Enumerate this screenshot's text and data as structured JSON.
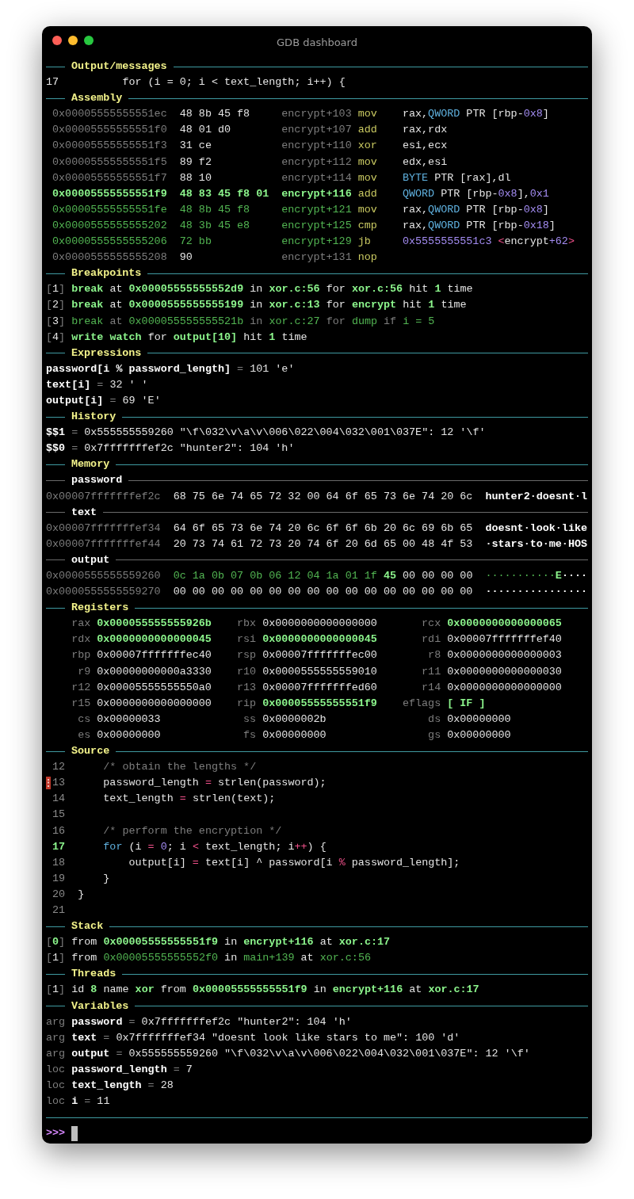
{
  "window": {
    "title": "GDB dashboard"
  },
  "sections": [
    {
      "title": "Output/messages",
      "kind": "msg",
      "lines": [
        {
          "cells": [
            [
              {
                "text": "17",
                "kind": "plain"
              }
            ],
            [
              {
                "text": "for (i = 0; i < text_length; i++) {",
                "kind": "plain"
              }
            ]
          ]
        }
      ]
    },
    {
      "title": "Assembly",
      "kind": "asm",
      "lines": [
        {
          "cells": [
            [
              {
                "text": "0x00005555555551ec",
                "kind": "dim"
              }
            ],
            [
              {
                "text": "48 8b 45 f8",
                "kind": "plain"
              }
            ],
            [
              {
                "text": "encrypt+103",
                "kind": "dim"
              }
            ],
            [
              {
                "text": "mov",
                "kind": "yellow"
              }
            ],
            [
              {
                "text": "rax,",
                "kind": "plain"
              },
              {
                "text": "QWORD",
                "kind": "cyan"
              },
              {
                "text": " PTR [rbp-",
                "kind": "plain"
              },
              {
                "text": "0x8",
                "kind": "purple"
              },
              {
                "text": "]",
                "kind": "plain"
              }
            ]
          ]
        },
        {
          "cells": [
            [
              {
                "text": "0x00005555555551f0",
                "kind": "dim"
              }
            ],
            [
              {
                "text": "48 01 d0",
                "kind": "plain"
              }
            ],
            [
              {
                "text": "encrypt+107",
                "kind": "dim"
              }
            ],
            [
              {
                "text": "add",
                "kind": "yellow"
              }
            ],
            [
              {
                "text": "rax,rdx",
                "kind": "plain"
              }
            ]
          ]
        },
        {
          "cells": [
            [
              {
                "text": "0x00005555555551f3",
                "kind": "dim"
              }
            ],
            [
              {
                "text": "31 ce",
                "kind": "plain"
              }
            ],
            [
              {
                "text": "encrypt+110",
                "kind": "dim"
              }
            ],
            [
              {
                "text": "xor",
                "kind": "yellow"
              }
            ],
            [
              {
                "text": "esi,ecx",
                "kind": "plain"
              }
            ]
          ]
        },
        {
          "cells": [
            [
              {
                "text": "0x00005555555551f5",
                "kind": "dim"
              }
            ],
            [
              {
                "text": "89 f2",
                "kind": "plain"
              }
            ],
            [
              {
                "text": "encrypt+112",
                "kind": "dim"
              }
            ],
            [
              {
                "text": "mov",
                "kind": "yellow"
              }
            ],
            [
              {
                "text": "edx,esi",
                "kind": "plain"
              }
            ]
          ]
        },
        {
          "cells": [
            [
              {
                "text": "0x00005555555551f7",
                "kind": "dim"
              }
            ],
            [
              {
                "text": "88 10",
                "kind": "plain"
              }
            ],
            [
              {
                "text": "encrypt+114",
                "kind": "dim"
              }
            ],
            [
              {
                "text": "mov",
                "kind": "yellow"
              }
            ],
            [
              {
                "text": "BYTE",
                "kind": "cyan"
              },
              {
                "text": " PTR [rax],dl",
                "kind": "plain"
              }
            ]
          ]
        },
        {
          "cells": [
            [
              {
                "text": "0x00005555555551f9",
                "kind": "hi"
              }
            ],
            [
              {
                "text": "48 83 45 f8 01",
                "kind": "hi"
              }
            ],
            [
              {
                "text": "encrypt+116",
                "kind": "hi"
              }
            ],
            [
              {
                "text": "add",
                "kind": "yellow"
              }
            ],
            [
              {
                "text": "QWORD",
                "kind": "cyan"
              },
              {
                "text": " PTR [rbp-",
                "kind": "plain"
              },
              {
                "text": "0x8",
                "kind": "purple"
              },
              {
                "text": "],",
                "kind": "plain"
              },
              {
                "text": "0x1",
                "kind": "purple"
              }
            ]
          ]
        },
        {
          "cells": [
            [
              {
                "text": "0x00005555555551fe",
                "kind": "green"
              }
            ],
            [
              {
                "text": "48 8b 45 f8",
                "kind": "green"
              }
            ],
            [
              {
                "text": "encrypt+121",
                "kind": "green"
              }
            ],
            [
              {
                "text": "mov",
                "kind": "yellow"
              }
            ],
            [
              {
                "text": "rax,",
                "kind": "plain"
              },
              {
                "text": "QWORD",
                "kind": "cyan"
              },
              {
                "text": " PTR [rbp-",
                "kind": "plain"
              },
              {
                "text": "0x8",
                "kind": "purple"
              },
              {
                "text": "]",
                "kind": "plain"
              }
            ]
          ]
        },
        {
          "cells": [
            [
              {
                "text": "0x0000555555555202",
                "kind": "green"
              }
            ],
            [
              {
                "text": "48 3b 45 e8",
                "kind": "green"
              }
            ],
            [
              {
                "text": "encrypt+125",
                "kind": "green"
              }
            ],
            [
              {
                "text": "cmp",
                "kind": "yellow"
              }
            ],
            [
              {
                "text": "rax,",
                "kind": "plain"
              },
              {
                "text": "QWORD",
                "kind": "cyan"
              },
              {
                "text": " PTR [rbp-",
                "kind": "plain"
              },
              {
                "text": "0x18",
                "kind": "purple"
              },
              {
                "text": "]",
                "kind": "plain"
              }
            ]
          ]
        },
        {
          "cells": [
            [
              {
                "text": "0x0000555555555206",
                "kind": "green"
              }
            ],
            [
              {
                "text": "72 bb",
                "kind": "green"
              }
            ],
            [
              {
                "text": "encrypt+129",
                "kind": "green"
              }
            ],
            [
              {
                "text": "jb",
                "kind": "yellow"
              }
            ],
            [
              {
                "text": "0x5555555551c3",
                "kind": "purple"
              },
              {
                "text": " <",
                "kind": "red"
              },
              {
                "text": "encrypt",
                "kind": "plain"
              },
              {
                "text": "+62",
                "kind": "purple"
              },
              {
                "text": ">",
                "kind": "red"
              }
            ]
          ]
        },
        {
          "cells": [
            [
              {
                "text": "0x0000555555555208",
                "kind": "dim"
              }
            ],
            [
              {
                "text": "90",
                "kind": "plain"
              }
            ],
            [
              {
                "text": "encrypt+131",
                "kind": "dim"
              }
            ],
            [
              {
                "text": "nop",
                "kind": "yellow"
              }
            ],
            []
          ]
        }
      ]
    },
    {
      "title": "Breakpoints",
      "kind": "text",
      "lines": [
        {
          "cells": [
            [
              {
                "text": "[",
                "kind": "dim"
              },
              {
                "text": "1",
                "kind": "plain"
              },
              {
                "text": "] ",
                "kind": "dim"
              },
              {
                "text": "break",
                "kind": "hi"
              },
              {
                "text": " at ",
                "kind": "plain"
              },
              {
                "text": "0x00005555555552d9",
                "kind": "hi"
              },
              {
                "text": " in ",
                "kind": "plain"
              },
              {
                "text": "xor.c:56",
                "kind": "hi"
              },
              {
                "text": " for ",
                "kind": "plain"
              },
              {
                "text": "xor.c:56",
                "kind": "hi"
              },
              {
                "text": " hit ",
                "kind": "plain"
              },
              {
                "text": "1",
                "kind": "hi"
              },
              {
                "text": " time",
                "kind": "plain"
              }
            ]
          ]
        },
        {
          "cells": [
            [
              {
                "text": "[",
                "kind": "dim"
              },
              {
                "text": "2",
                "kind": "plain"
              },
              {
                "text": "] ",
                "kind": "dim"
              },
              {
                "text": "break",
                "kind": "hi"
              },
              {
                "text": " at ",
                "kind": "plain"
              },
              {
                "text": "0x0000555555555199",
                "kind": "hi"
              },
              {
                "text": " in ",
                "kind": "plain"
              },
              {
                "text": "xor.c:13",
                "kind": "hi"
              },
              {
                "text": " for ",
                "kind": "plain"
              },
              {
                "text": "encrypt",
                "kind": "hi"
              },
              {
                "text": " hit ",
                "kind": "plain"
              },
              {
                "text": "1",
                "kind": "hi"
              },
              {
                "text": " time",
                "kind": "plain"
              }
            ]
          ]
        },
        {
          "cells": [
            [
              {
                "text": "[",
                "kind": "dim"
              },
              {
                "text": "3",
                "kind": "plain"
              },
              {
                "text": "] ",
                "kind": "dim"
              },
              {
                "text": "break",
                "kind": "green"
              },
              {
                "text": " at ",
                "kind": "dim"
              },
              {
                "text": "0x000055555555521b",
                "kind": "green"
              },
              {
                "text": " in ",
                "kind": "dim"
              },
              {
                "text": "xor.c:27",
                "kind": "green"
              },
              {
                "text": " for ",
                "kind": "dim"
              },
              {
                "text": "dump",
                "kind": "green"
              },
              {
                "text": " if ",
                "kind": "dim"
              },
              {
                "text": "i = 5",
                "kind": "green"
              }
            ]
          ]
        },
        {
          "cells": [
            [
              {
                "text": "[",
                "kind": "dim"
              },
              {
                "text": "4",
                "kind": "plain"
              },
              {
                "text": "] ",
                "kind": "dim"
              },
              {
                "text": "write watch",
                "kind": "hi"
              },
              {
                "text": " for ",
                "kind": "plain"
              },
              {
                "text": "output[10]",
                "kind": "hi"
              },
              {
                "text": " hit ",
                "kind": "plain"
              },
              {
                "text": "1",
                "kind": "hi"
              },
              {
                "text": " time",
                "kind": "plain"
              }
            ]
          ]
        }
      ]
    },
    {
      "title": "Expressions",
      "kind": "text",
      "lines": [
        {
          "cells": [
            [
              {
                "text": "password[i % password_length]",
                "kind": "bold"
              },
              {
                "text": " = ",
                "kind": "dim"
              },
              {
                "text": "101 'e'",
                "kind": "plain"
              }
            ]
          ]
        },
        {
          "cells": [
            [
              {
                "text": "text[i]",
                "kind": "bold"
              },
              {
                "text": " = ",
                "kind": "dim"
              },
              {
                "text": "32 ' '",
                "kind": "plain"
              }
            ]
          ]
        },
        {
          "cells": [
            [
              {
                "text": "output[i]",
                "kind": "bold"
              },
              {
                "text": " = ",
                "kind": "dim"
              },
              {
                "text": "69 'E'",
                "kind": "plain"
              }
            ]
          ]
        }
      ]
    },
    {
      "title": "History",
      "kind": "text",
      "lines": [
        {
          "cells": [
            [
              {
                "text": "$$1",
                "kind": "bold"
              },
              {
                "text": " = ",
                "kind": "dim"
              },
              {
                "text": "0x555555559260 \"\\f\\032\\v\\a\\v\\006\\022\\004\\032\\001\\037E\": 12 '\\f'",
                "kind": "plain"
              }
            ]
          ]
        },
        {
          "cells": [
            [
              {
                "text": "$$0",
                "kind": "bold"
              },
              {
                "text": " = ",
                "kind": "dim"
              },
              {
                "text": "0x7fffffffef2c \"hunter2\": 104 'h'",
                "kind": "plain"
              }
            ]
          ]
        }
      ]
    },
    {
      "title": "Memory",
      "kind": "mem",
      "lines": [
        {
          "subtitle": "password"
        },
        {
          "cells": [
            [
              {
                "text": "0x00007fffffffef2c",
                "kind": "dim"
              }
            ],
            [
              {
                "text": "68 75 6e 74 65 72 32 00 64 6f 65 73 6e 74 20 6c",
                "kind": "plain"
              }
            ],
            [
              {
                "text": "hunter2·doesnt·l",
                "kind": "bold"
              }
            ]
          ]
        },
        {
          "subtitle": "text"
        },
        {
          "cells": [
            [
              {
                "text": "0x00007fffffffef34",
                "kind": "dim"
              }
            ],
            [
              {
                "text": "64 6f 65 73 6e 74 20 6c 6f 6f 6b 20 6c 69 6b 65",
                "kind": "plain"
              }
            ],
            [
              {
                "text": "doesnt·look·like",
                "kind": "bold"
              }
            ]
          ]
        },
        {
          "cells": [
            [
              {
                "text": "0x00007fffffffef44",
                "kind": "dim"
              }
            ],
            [
              {
                "text": "20 73 74 61 72 73 20 74 6f 20 6d 65 00 48 4f 53",
                "kind": "plain"
              }
            ],
            [
              {
                "text": "·stars·to·me·HOS",
                "kind": "bold"
              }
            ]
          ]
        },
        {
          "subtitle": "output"
        },
        {
          "cells": [
            [
              {
                "text": "0x0000555555559260",
                "kind": "dim"
              }
            ],
            [
              {
                "text": "0c 1a 0b 07 0b 06 12 04 1a 01 1f ",
                "kind": "green"
              },
              {
                "text": "45",
                "kind": "hi"
              },
              {
                "text": " 00 00 00 00",
                "kind": "plain"
              }
            ],
            [
              {
                "text": "···········",
                "kind": "green"
              },
              {
                "text": "E",
                "kind": "hi"
              },
              {
                "text": "····",
                "kind": "bold"
              }
            ]
          ]
        },
        {
          "cells": [
            [
              {
                "text": "0x0000555555559270",
                "kind": "dim"
              }
            ],
            [
              {
                "text": "00 00 00 00 00 00 00 00 00 00 00 00 00 00 00 00",
                "kind": "plain"
              }
            ],
            [
              {
                "text": "················",
                "kind": "bold"
              }
            ]
          ]
        }
      ]
    },
    {
      "title": "Registers",
      "kind": "regs",
      "registers": [
        {
          "name": "rax",
          "value": "0x000055555555926b",
          "changed": true
        },
        {
          "name": "rbx",
          "value": "0x0000000000000000",
          "changed": false
        },
        {
          "name": "rcx",
          "value": "0x0000000000000065",
          "changed": true
        },
        {
          "name": "rdx",
          "value": "0x0000000000000045",
          "changed": true
        },
        {
          "name": "rsi",
          "value": "0x0000000000000045",
          "changed": true
        },
        {
          "name": "rdi",
          "value": "0x00007fffffffef40",
          "changed": false
        },
        {
          "name": "rbp",
          "value": "0x00007fffffffec40",
          "changed": false
        },
        {
          "name": "rsp",
          "value": "0x00007fffffffec00",
          "changed": false
        },
        {
          "name": "r8",
          "value": "0x0000000000000003",
          "changed": false
        },
        {
          "name": "r9",
          "value": "0x00000000000a3330",
          "changed": false
        },
        {
          "name": "r10",
          "value": "0x0000555555559010",
          "changed": false
        },
        {
          "name": "r11",
          "value": "0x0000000000000030",
          "changed": false
        },
        {
          "name": "r12",
          "value": "0x00005555555550a0",
          "changed": false
        },
        {
          "name": "r13",
          "value": "0x00007fffffffed60",
          "changed": false
        },
        {
          "name": "r14",
          "value": "0x0000000000000000",
          "changed": false
        },
        {
          "name": "r15",
          "value": "0x0000000000000000",
          "changed": false
        },
        {
          "name": "rip",
          "value": "0x00005555555551f9",
          "changed": true
        },
        {
          "name": "eflags",
          "value": "[ IF ]",
          "changed": true
        },
        {
          "name": "cs",
          "value": "0x00000033",
          "changed": false
        },
        {
          "name": "ss",
          "value": "0x0000002b",
          "changed": false
        },
        {
          "name": "ds",
          "value": "0x00000000",
          "changed": false
        },
        {
          "name": "es",
          "value": "0x00000000",
          "changed": false
        },
        {
          "name": "fs",
          "value": "0x00000000",
          "changed": false
        },
        {
          "name": "gs",
          "value": "0x00000000",
          "changed": false
        }
      ]
    },
    {
      "title": "Source",
      "kind": "source",
      "lines": [
        {
          "number": "12",
          "current": false,
          "breakpoint": false,
          "code": [
            {
              "text": "    /* obtain the lengths */",
              "kind": "dim"
            }
          ]
        },
        {
          "number": "13",
          "current": false,
          "breakpoint": true,
          "code": [
            {
              "text": "    password_length ",
              "kind": "plain"
            },
            {
              "text": "=",
              "kind": "red"
            },
            {
              "text": " strlen(password);",
              "kind": "plain"
            }
          ]
        },
        {
          "number": "14",
          "current": false,
          "breakpoint": false,
          "code": [
            {
              "text": "    text_length ",
              "kind": "plain"
            },
            {
              "text": "=",
              "kind": "red"
            },
            {
              "text": " strlen(text);",
              "kind": "plain"
            }
          ]
        },
        {
          "number": "15",
          "current": false,
          "breakpoint": false
        },
        {
          "number": "16",
          "current": false,
          "breakpoint": false,
          "code": [
            {
              "text": "    /* perform the encryption */",
              "kind": "dim"
            }
          ]
        },
        {
          "number": "17",
          "current": true,
          "breakpoint": false,
          "code": [
            {
              "text": "    for",
              "kind": "cyan"
            },
            {
              "text": " (i ",
              "kind": "plain"
            },
            {
              "text": "=",
              "kind": "red"
            },
            {
              "text": " 0",
              "kind": "purple"
            },
            {
              "text": "; i ",
              "kind": "plain"
            },
            {
              "text": "<",
              "kind": "red"
            },
            {
              "text": " text_length; i",
              "kind": "plain"
            },
            {
              "text": "++",
              "kind": "red"
            },
            {
              "text": ") {",
              "kind": "plain"
            }
          ]
        },
        {
          "number": "18",
          "current": false,
          "breakpoint": false,
          "code": [
            {
              "text": "        output[i] ",
              "kind": "plain"
            },
            {
              "text": "=",
              "kind": "red"
            },
            {
              "text": " text[i] ^ password[i ",
              "kind": "plain"
            },
            {
              "text": "%",
              "kind": "red"
            },
            {
              "text": " password_length];",
              "kind": "plain"
            }
          ]
        },
        {
          "number": "19",
          "current": false,
          "breakpoint": false,
          "code": [
            {
              "text": "    }",
              "kind": "plain"
            }
          ]
        },
        {
          "number": "20",
          "current": false,
          "breakpoint": false,
          "code": [
            {
              "text": "}",
              "kind": "plain"
            }
          ]
        },
        {
          "number": "21",
          "current": false,
          "breakpoint": false
        }
      ]
    },
    {
      "title": "Stack",
      "kind": "text",
      "lines": [
        {
          "cells": [
            [
              {
                "text": "[",
                "kind": "dim"
              },
              {
                "text": "0",
                "kind": "hi"
              },
              {
                "text": "] ",
                "kind": "dim"
              },
              {
                "text": "from ",
                "kind": "plain"
              },
              {
                "text": "0x00005555555551f9",
                "kind": "hi"
              },
              {
                "text": " in ",
                "kind": "plain"
              },
              {
                "text": "encrypt+116",
                "kind": "hi"
              },
              {
                "text": " at ",
                "kind": "plain"
              },
              {
                "text": "xor.c:17",
                "kind": "hi"
              }
            ]
          ]
        },
        {
          "cells": [
            [
              {
                "text": "[",
                "kind": "dim"
              },
              {
                "text": "1",
                "kind": "plain"
              },
              {
                "text": "] ",
                "kind": "dim"
              },
              {
                "text": "from ",
                "kind": "plain"
              },
              {
                "text": "0x00005555555552f0",
                "kind": "green"
              },
              {
                "text": " in ",
                "kind": "plain"
              },
              {
                "text": "main+139",
                "kind": "green"
              },
              {
                "text": " at ",
                "kind": "plain"
              },
              {
                "text": "xor.c:56",
                "kind": "green"
              }
            ]
          ]
        }
      ]
    },
    {
      "title": "Threads",
      "kind": "text",
      "lines": [
        {
          "cells": [
            [
              {
                "text": "[",
                "kind": "dim"
              },
              {
                "text": "1",
                "kind": "plain"
              },
              {
                "text": "] ",
                "kind": "dim"
              },
              {
                "text": "id ",
                "kind": "plain"
              },
              {
                "text": "8",
                "kind": "hi"
              },
              {
                "text": " name ",
                "kind": "plain"
              },
              {
                "text": "xor",
                "kind": "hi"
              },
              {
                "text": " from ",
                "kind": "plain"
              },
              {
                "text": "0x00005555555551f9",
                "kind": "hi"
              },
              {
                "text": " in ",
                "kind": "plain"
              },
              {
                "text": "encrypt+116",
                "kind": "hi"
              },
              {
                "text": " at ",
                "kind": "plain"
              },
              {
                "text": "xor.c:17",
                "kind": "hi"
              }
            ]
          ]
        }
      ]
    },
    {
      "title": "Variables",
      "kind": "text",
      "lines": [
        {
          "cells": [
            [
              {
                "text": "arg ",
                "kind": "dim"
              },
              {
                "text": "password",
                "kind": "bold"
              },
              {
                "text": " = ",
                "kind": "dim"
              },
              {
                "text": "0x7fffffffef2c \"hunter2\": 104 'h'",
                "kind": "plain"
              }
            ]
          ]
        },
        {
          "cells": [
            [
              {
                "text": "arg ",
                "kind": "dim"
              },
              {
                "text": "text",
                "kind": "bold"
              },
              {
                "text": " = ",
                "kind": "dim"
              },
              {
                "text": "0x7fffffffef34 \"doesnt look like stars to me\": 100 'd'",
                "kind": "plain"
              }
            ]
          ]
        },
        {
          "cells": [
            [
              {
                "text": "arg ",
                "kind": "dim"
              },
              {
                "text": "output",
                "kind": "bold"
              },
              {
                "text": " = ",
                "kind": "dim"
              },
              {
                "text": "0x555555559260 \"\\f\\032\\v\\a\\v\\006\\022\\004\\032\\001\\037E\": 12 '\\f'",
                "kind": "plain"
              }
            ]
          ]
        },
        {
          "cells": [
            [
              {
                "text": "loc ",
                "kind": "dim"
              },
              {
                "text": "password_length",
                "kind": "bold"
              },
              {
                "text": " = ",
                "kind": "dim"
              },
              {
                "text": "7",
                "kind": "plain"
              }
            ]
          ]
        },
        {
          "cells": [
            [
              {
                "text": "loc ",
                "kind": "dim"
              },
              {
                "text": "text_length",
                "kind": "bold"
              },
              {
                "text": " = ",
                "kind": "dim"
              },
              {
                "text": "28",
                "kind": "plain"
              }
            ]
          ]
        },
        {
          "cells": [
            [
              {
                "text": "loc ",
                "kind": "dim"
              },
              {
                "text": "i",
                "kind": "bold"
              },
              {
                "text": " = ",
                "kind": "dim"
              },
              {
                "text": "11",
                "kind": "plain"
              }
            ]
          ]
        }
      ]
    }
  ],
  "prompt": {
    "text": ">>>"
  }
}
